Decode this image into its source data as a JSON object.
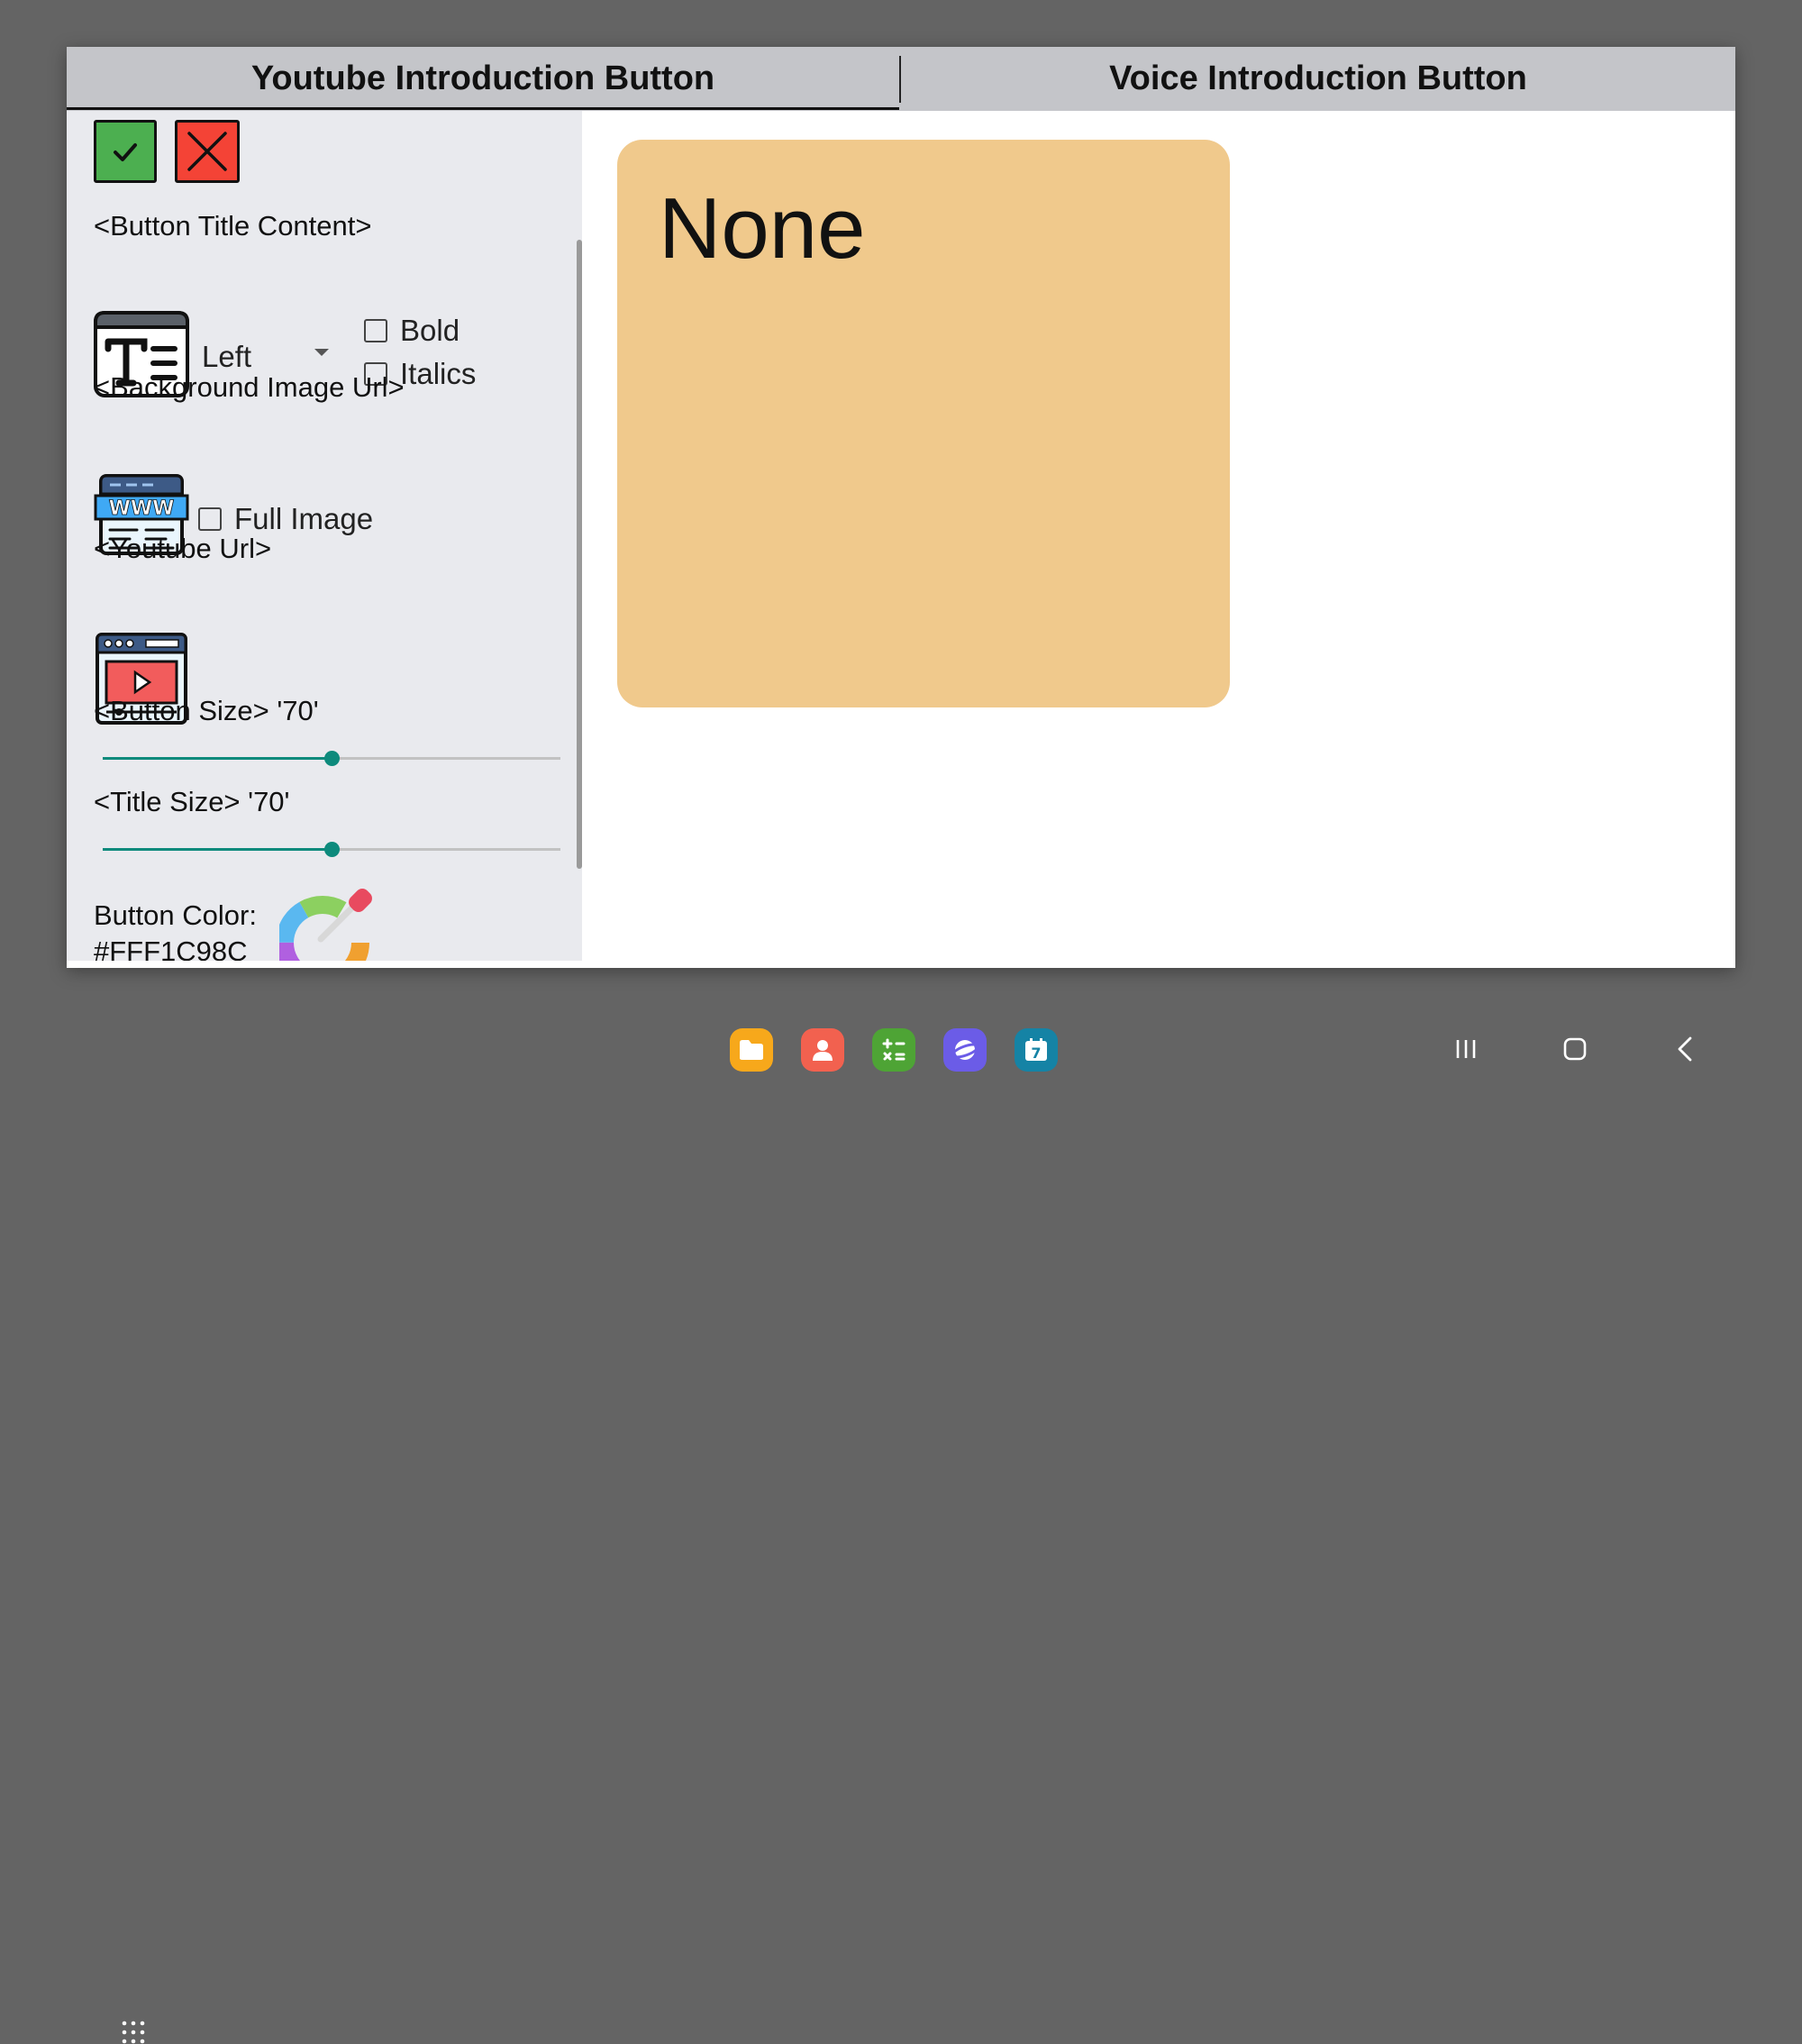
{
  "tabs": [
    {
      "label": "Youtube Introduction Button",
      "active": true
    },
    {
      "label": "Voice Introduction Button",
      "active": false
    }
  ],
  "panel": {
    "title_content_label": "<Button Title Content>",
    "alignment_value": "Left",
    "bold_label": "Bold",
    "bold_checked": false,
    "italics_label": "Italics",
    "italics_checked": false,
    "background_url_label": "<Background Image Url>",
    "full_image_label": "Full Image",
    "full_image_checked": false,
    "youtube_url_label": "<Youtube Url>",
    "button_size_label": "<Button Size> '70'",
    "button_size_value": 70,
    "title_size_label": "<Title Size> '70'",
    "title_size_value": 70,
    "slider_max": 140,
    "button_color_label": "Button Color:",
    "button_color_value": "#FFF1C98C"
  },
  "preview": {
    "title": "None",
    "color": "#f0c98c"
  },
  "colors": {
    "accent": "#0d8a7c",
    "confirm": "#4caf50",
    "cancel": "#f44336"
  },
  "navbar": {
    "apps": [
      "apps-grid-icon",
      "my-files-icon",
      "contacts-icon",
      "calculator-icon",
      "internet-icon",
      "calendar-icon"
    ],
    "calendar_day": "7",
    "buttons": [
      "recents-icon",
      "home-icon",
      "back-icon"
    ]
  }
}
